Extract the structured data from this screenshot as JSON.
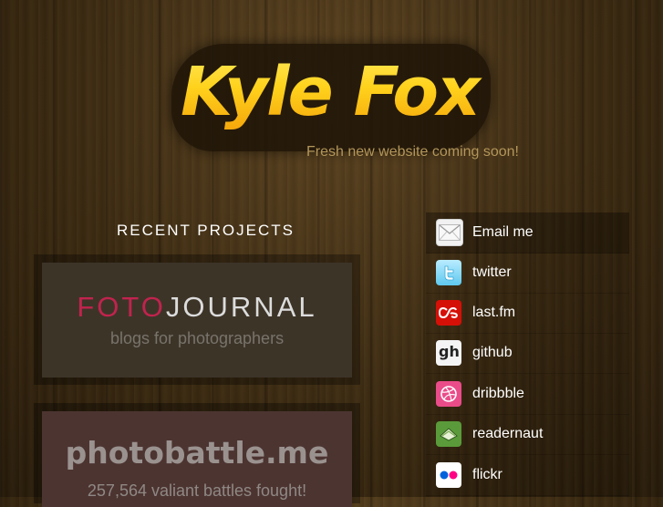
{
  "brand": {
    "logo_text": "Kyle Fox",
    "tagline": "Fresh new website coming soon!"
  },
  "projects": {
    "heading": "RECENT PROJECTS",
    "items": [
      {
        "title_part1": "FOTO",
        "title_part2": "JOURNAL",
        "subtitle": "blogs for photographers"
      },
      {
        "title": "photobattle.me",
        "subtitle": "257,564 valiant battles fought!"
      }
    ]
  },
  "links": [
    {
      "label": "Email me",
      "icon": "envelope-icon"
    },
    {
      "label": "twitter",
      "icon": "twitter-icon"
    },
    {
      "label": "last.fm",
      "icon": "lastfm-icon"
    },
    {
      "label": "github",
      "icon": "github-icon"
    },
    {
      "label": "dribbble",
      "icon": "dribbble-icon"
    },
    {
      "label": "readernaut",
      "icon": "readernaut-icon"
    },
    {
      "label": "flickr",
      "icon": "flickr-icon"
    }
  ]
}
